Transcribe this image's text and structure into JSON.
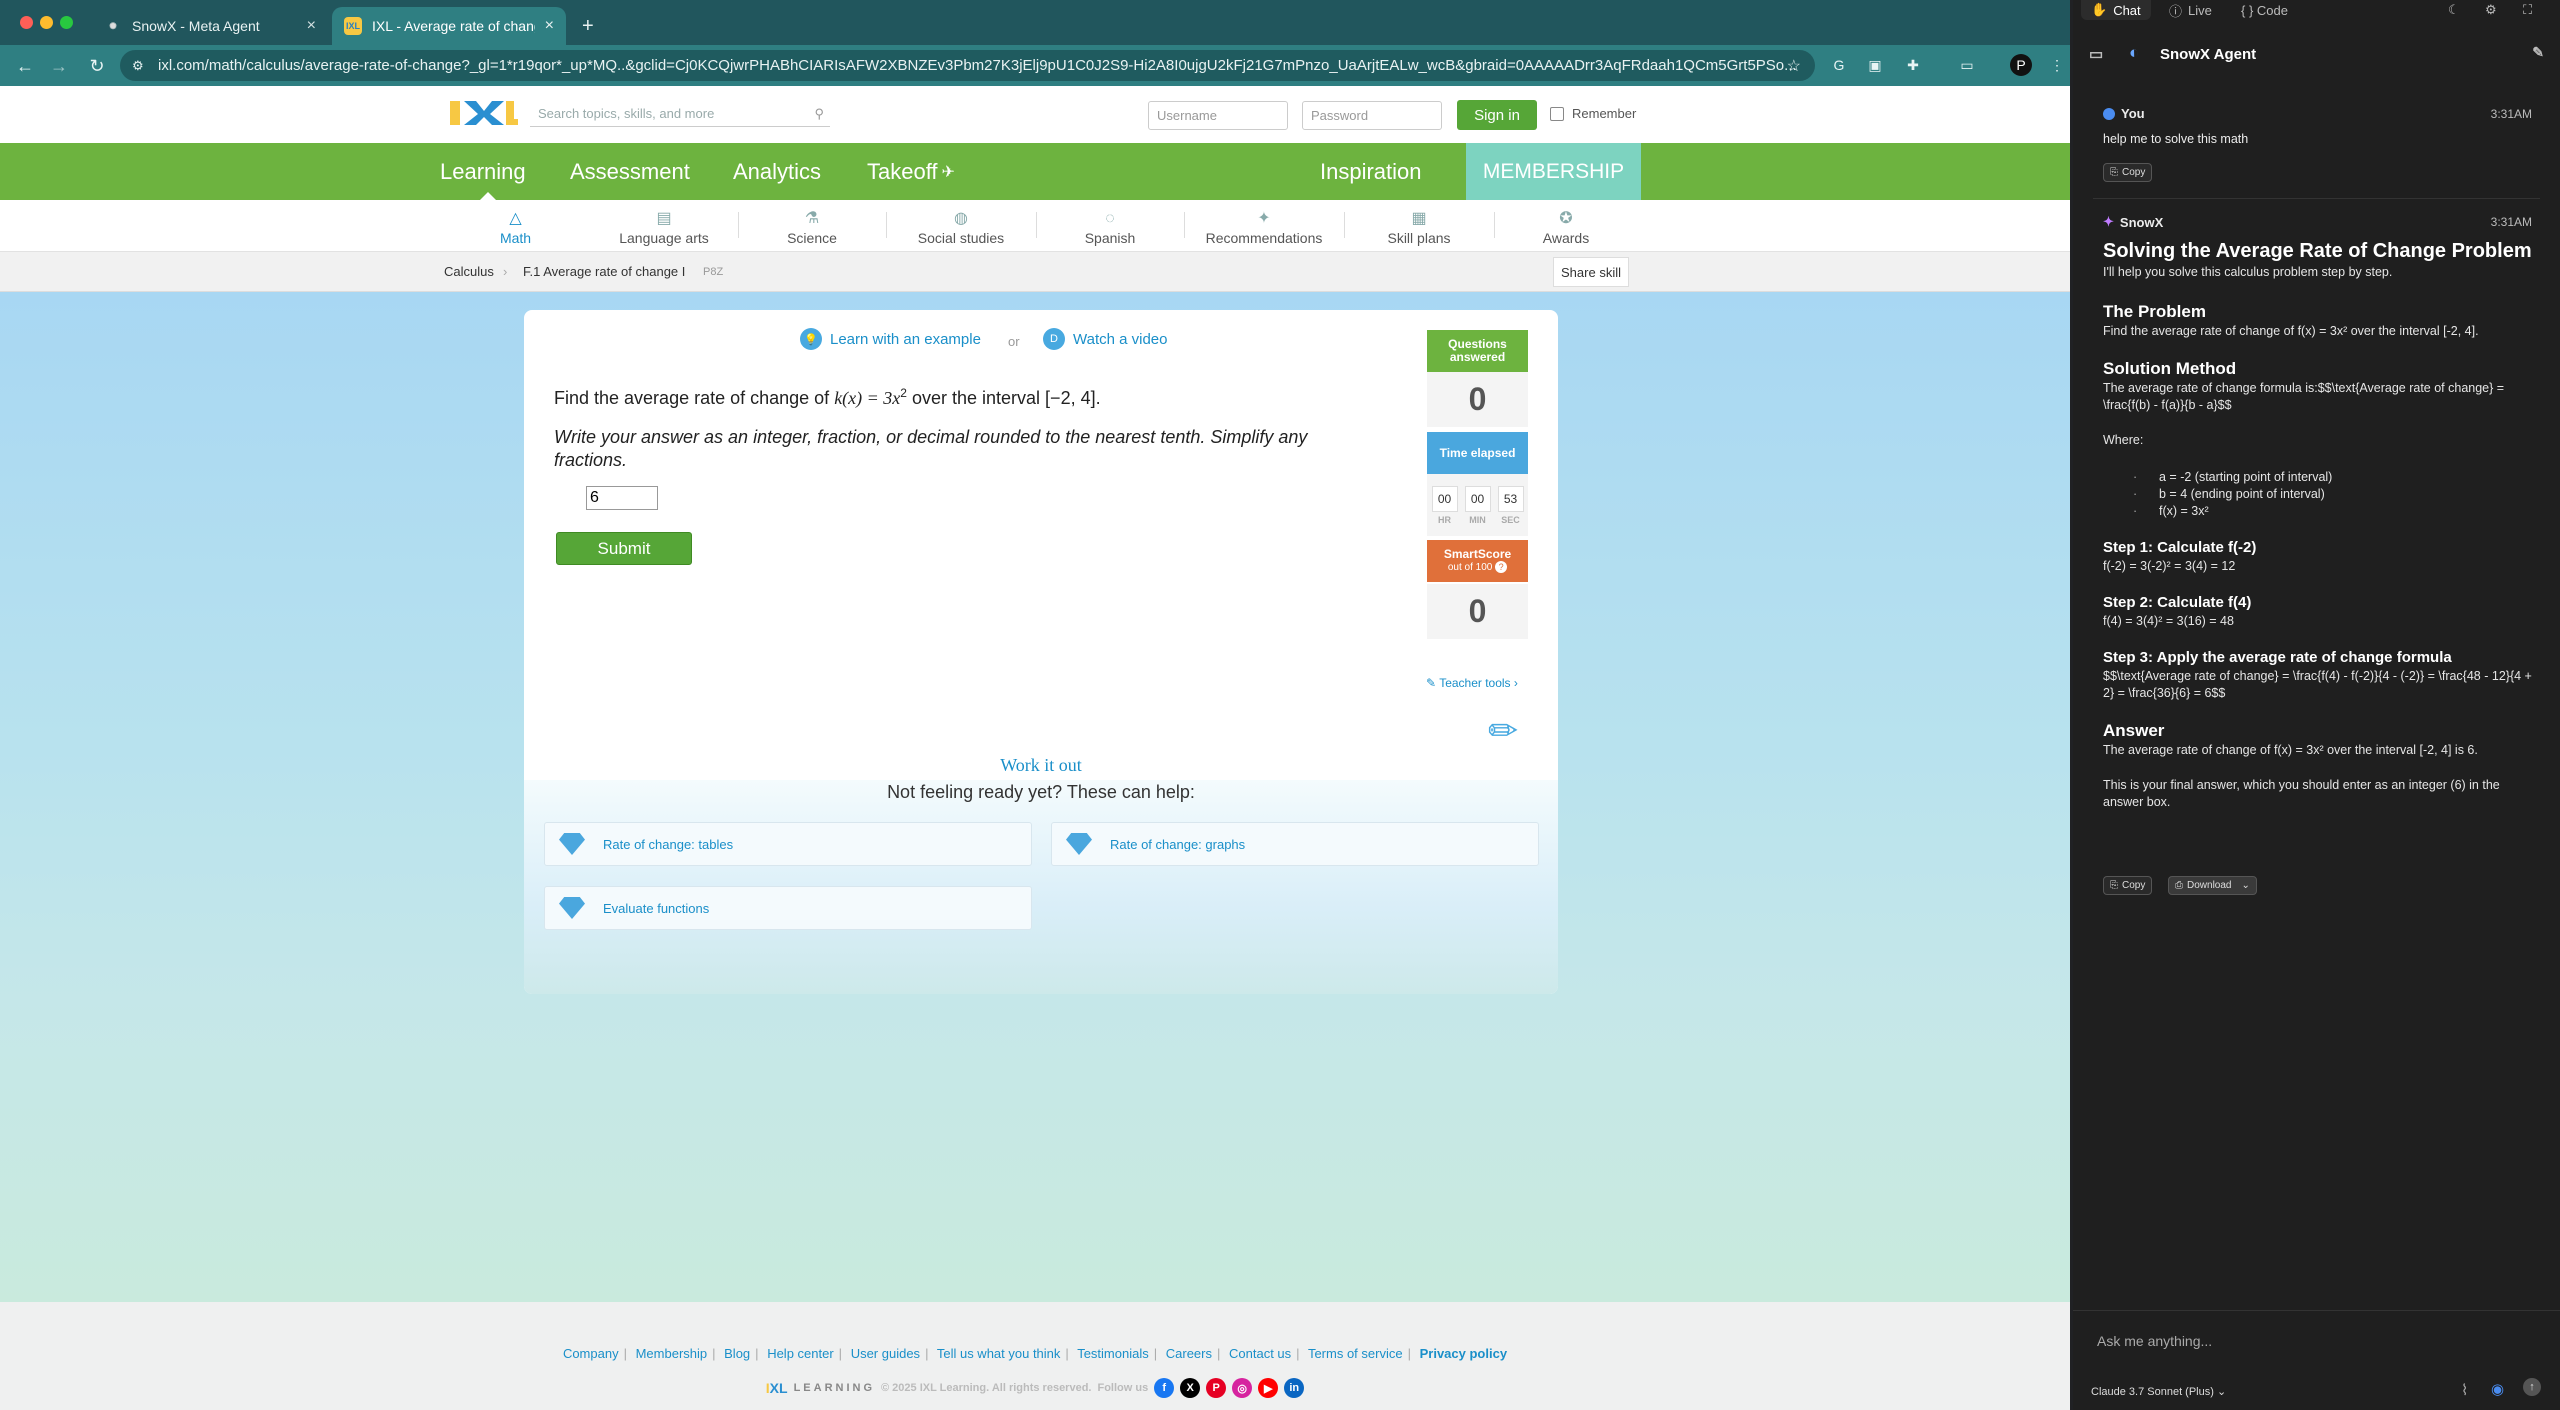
{
  "browser": {
    "tabs": [
      {
        "label": "SnowX - Meta Agent",
        "active": false
      },
      {
        "label": "IXL - Average rate of change",
        "active": true
      }
    ],
    "url": "ixl.com/math/calculus/average-rate-of-change?_gl=1*r19qor*_up*MQ..&gclid=Cj0KCQjwrPHABhCIARIsAFW2XBNZEv3Pbm27K3jElj9pU1C0J2S9-Hi2A8I0ujgU2kFj21G7mPnzo_UaArjtEALw_wcB&gbraid=0AAAAADrr3AqFRdaah1QCm5Grt5PSo..."
  },
  "ixl": {
    "search_placeholder": "Search topics, skills, and more",
    "username_placeholder": "Username",
    "password_placeholder": "Password",
    "signin": "Sign in",
    "remember": "Remember",
    "nav": {
      "learning": "Learning",
      "assessment": "Assessment",
      "analytics": "Analytics",
      "takeoff": "Takeoff",
      "inspiration": "Inspiration",
      "membership": "MEMBERSHIP"
    },
    "subjects": [
      "Math",
      "Language arts",
      "Science",
      "Social studies",
      "Spanish",
      "Recommendations",
      "Skill plans",
      "Awards"
    ],
    "breadcrumb": {
      "section": "Calculus",
      "skill": "F.1 Average rate of change I",
      "code": "P8Z",
      "share": "Share skill"
    },
    "help": {
      "example": "Learn with an example",
      "or": "or",
      "video": "Watch a video"
    },
    "question": {
      "prefix": "Find the average rate of change of ",
      "func": "k(x) = 3x",
      "exp": "2",
      "suffix": " over the interval [−2, 4].",
      "instructions": "Write your answer as an integer, fraction, or decimal rounded to the nearest tenth. Simplify any fractions.",
      "answer": "6",
      "submit": "Submit"
    },
    "stats": {
      "questions_label": "Questions answered",
      "questions_value": "0",
      "time_label": "Time elapsed",
      "hr": "00",
      "min": "00",
      "sec": "53",
      "hr_label": "HR",
      "min_label": "MIN",
      "sec_label": "SEC",
      "smart_label": "SmartScore",
      "smart_sub": "out of 100",
      "smart_value": "0",
      "teacher_tools": "Teacher tools ›"
    },
    "workitout": {
      "title": "Work it out",
      "subtitle": "Not feeling ready yet? These can help:",
      "skills": [
        "Rate of change: tables",
        "Rate of change: graphs",
        "Evaluate functions"
      ]
    },
    "footer": {
      "links": [
        "Company",
        "Membership",
        "Blog",
        "Help center",
        "User guides",
        "Tell us what you think",
        "Testimonials",
        "Careers",
        "Contact us",
        "Terms of service",
        "Privacy policy"
      ],
      "brand": "LEARNING",
      "copyright": "© 2025 IXL Learning. All rights reserved.",
      "follow": "Follow us"
    }
  },
  "panel": {
    "tabs": [
      "Chat",
      "Live",
      "{ } Code"
    ],
    "title": "SnowX Agent",
    "user": {
      "name": "You",
      "time": "3:31AM",
      "text": "help me to solve this math",
      "copy": "Copy"
    },
    "agent": {
      "name": "SnowX",
      "time": "3:31AM"
    },
    "response": {
      "title": "Solving the Average Rate of Change Problem",
      "intro": "I'll help you solve this calculus problem step by step.",
      "problem_h": "The Problem",
      "problem": "Find the average rate of change of f(x) = 3x² over the interval [-2, 4].",
      "method_h": "Solution Method",
      "method": "The average rate of change formula is:$$\\text{Average rate of change} = \\frac{f(b) - f(a)}{b - a}$$",
      "where": "Where:",
      "where_items": [
        "a = -2 (starting point of interval)",
        "b = 4 (ending point of interval)",
        "f(x) = 3x²"
      ],
      "step1_h": "Step 1: Calculate f(-2)",
      "step1": "f(-2) = 3(-2)² = 3(4) = 12",
      "step2_h": "Step 2: Calculate f(4)",
      "step2": "f(4) = 3(4)² = 3(16) = 48",
      "step3_h": "Step 3: Apply the average rate of change formula",
      "step3": "$$\\text{Average rate of change} = \\frac{f(4) - f(-2)}{4 - (-2)} = \\frac{48 - 12}{4 + 2} = \\frac{36}{6} = 6$$",
      "answer_h": "Answer",
      "answer": "The average rate of change of f(x) = 3x² over the interval [-2, 4] is 6.",
      "final": "This is your final answer, which you should enter as an integer (6) in the answer box."
    },
    "copy": "Copy",
    "download": "Download",
    "ask_placeholder": "Ask me anything...",
    "model": "Claude 3.7 Sonnet (Plus) ⌄"
  }
}
